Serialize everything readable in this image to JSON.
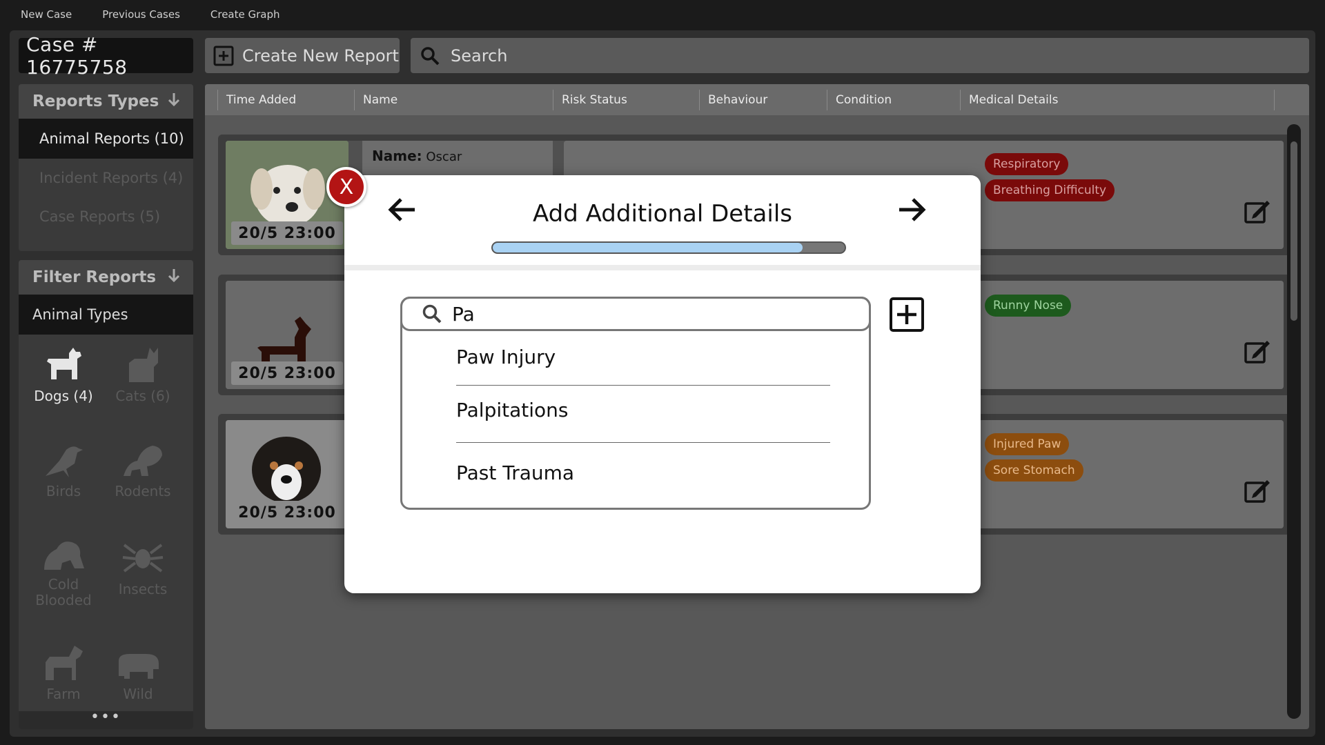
{
  "menu": {
    "new_case": "New Case",
    "previous_cases": "Previous Cases",
    "create_graph": "Create Graph"
  },
  "case_label": "Case # 16775758",
  "toolbar": {
    "create_label": "Create New Report",
    "search_placeholder": "Search"
  },
  "report_types": {
    "title": "Reports Types",
    "items": [
      "Animal Reports (10)",
      "Incident Reports (4)",
      "Case Reports (5)"
    ]
  },
  "filter": {
    "title": "Filter Reports",
    "subtitle": "Animal Types",
    "cells": [
      {
        "label": "Dogs",
        "count": "(4)",
        "icon": "dog-icon"
      },
      {
        "label": "Cats",
        "count": "(6)",
        "icon": "cat-icon"
      },
      {
        "label": "Birds",
        "icon": "bird-icon"
      },
      {
        "label": "Rodents",
        "icon": "rodent-icon"
      },
      {
        "label1": "Cold",
        "label2": "Blooded",
        "icon": "frog-icon"
      },
      {
        "label": "Insects",
        "icon": "spider-icon"
      },
      {
        "label": "Farm",
        "icon": "horse-icon"
      },
      {
        "label": "Wild",
        "icon": "hippo-icon"
      }
    ],
    "more": "•••"
  },
  "table": {
    "columns": [
      "Time Added",
      "Name",
      "Risk Status",
      "Behaviour",
      "Condition",
      "Medical Details"
    ],
    "rows": [
      {
        "time": "20/5 23:00",
        "name_label": "Name:",
        "name": "Oscar",
        "tags": [
          "Respiratory",
          "Breathing Difficulty"
        ],
        "tag_color": "red"
      },
      {
        "time": "20/5 23:00",
        "tags": [
          "Runny Nose"
        ],
        "tag_color": "green"
      },
      {
        "time": "20/5 23:00",
        "tags": [
          "Injured Paw",
          "Sore Stomach"
        ],
        "tag_color": "orange"
      }
    ]
  },
  "modal": {
    "title": "Add Additional Details",
    "close_label": "X",
    "progress": 0.88,
    "search_value": "Pa",
    "options": [
      "Paw Injury",
      "Palpitations",
      "Past Trauma"
    ]
  },
  "colors": {
    "close": "#b31414",
    "progress_fill": "#a9d2f3",
    "tag_red": "#7a0a0a",
    "tag_green": "#1d5a1d",
    "tag_orange": "#8c4d0e"
  }
}
